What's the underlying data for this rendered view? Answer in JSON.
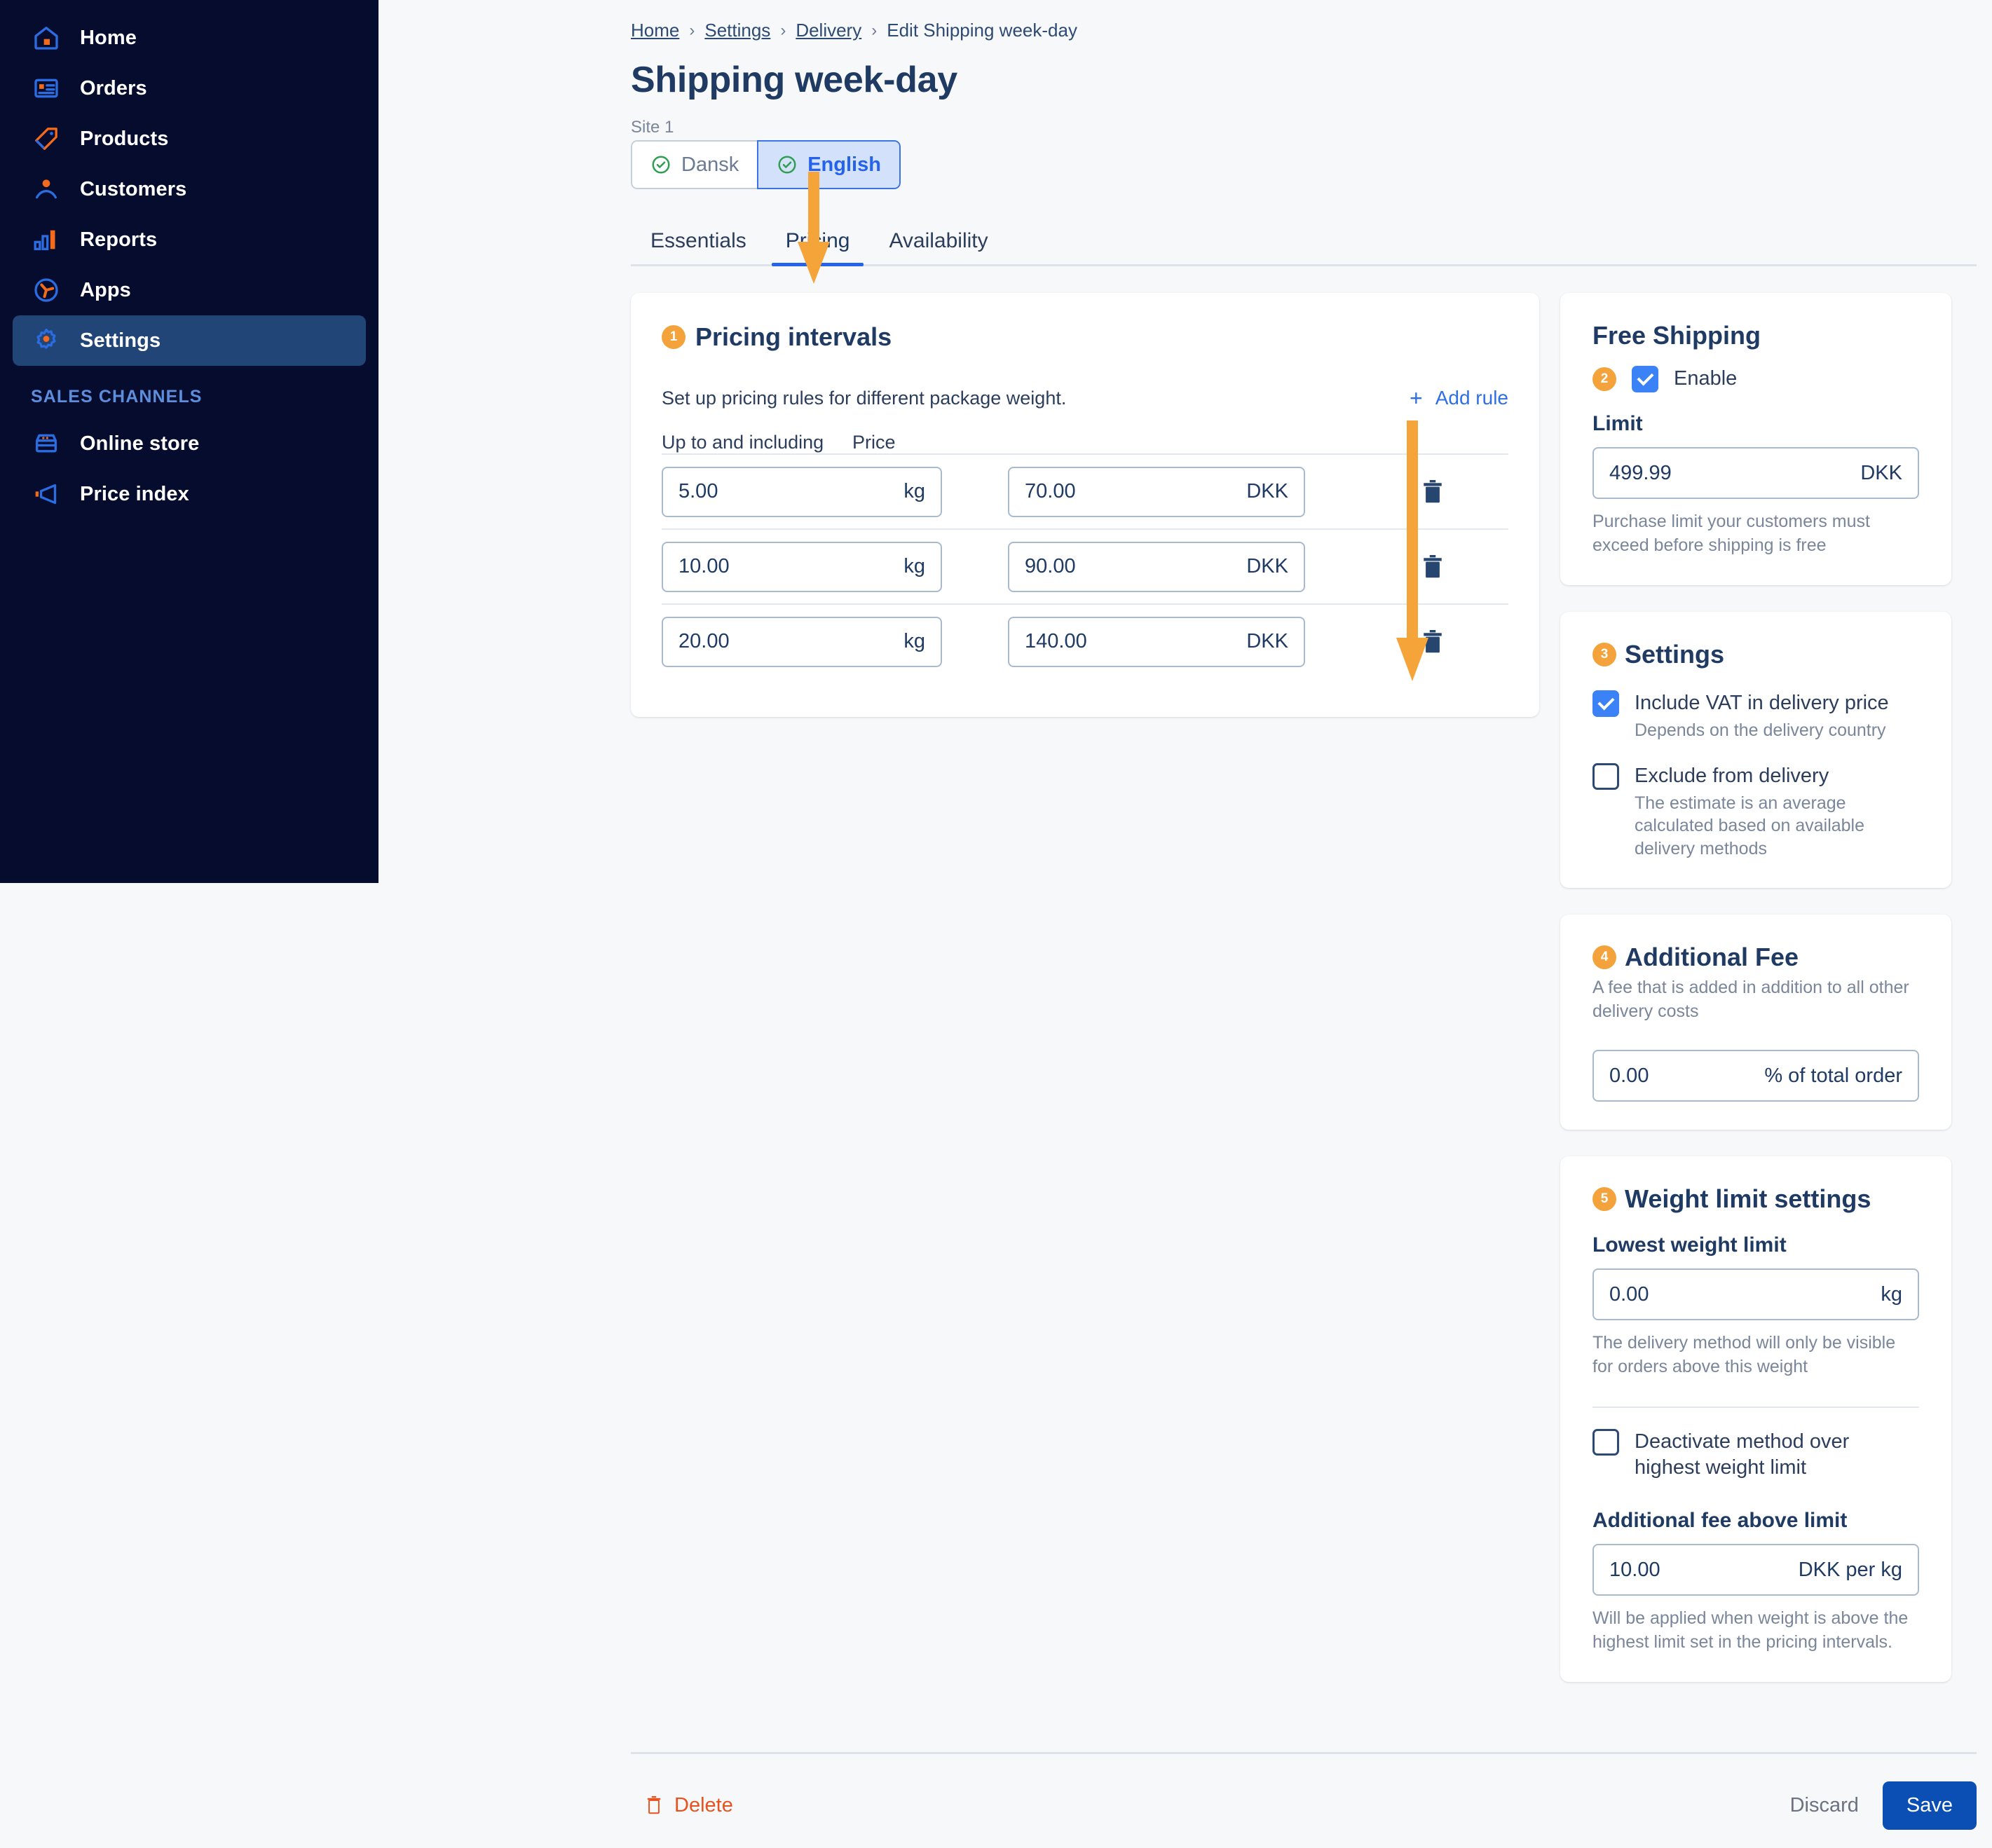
{
  "sidebar": {
    "items": [
      {
        "label": "Home",
        "icon": "home-icon"
      },
      {
        "label": "Orders",
        "icon": "orders-icon"
      },
      {
        "label": "Products",
        "icon": "products-tag-icon"
      },
      {
        "label": "Customers",
        "icon": "customers-icon"
      },
      {
        "label": "Reports",
        "icon": "reports-bar-chart-icon"
      },
      {
        "label": "Apps",
        "icon": "apps-icon"
      },
      {
        "label": "Settings",
        "icon": "gear-icon",
        "active": true
      }
    ],
    "section_label": "SALES CHANNELS",
    "channels": [
      {
        "label": "Online store",
        "icon": "store-icon"
      },
      {
        "label": "Price index",
        "icon": "megaphone-icon"
      }
    ]
  },
  "breadcrumb": {
    "items": [
      "Home",
      "Settings",
      "Delivery"
    ],
    "current": "Edit Shipping week-day",
    "separator": "›"
  },
  "header": {
    "title": "Shipping week-day",
    "site_label": "Site 1",
    "languages": [
      {
        "label": "Dansk",
        "selected": false
      },
      {
        "label": "English",
        "selected": true
      }
    ]
  },
  "tabs": [
    {
      "label": "Essentials",
      "active": false
    },
    {
      "label": "Pricing",
      "active": true
    },
    {
      "label": "Availability",
      "active": false
    }
  ],
  "pricing": {
    "badge": "1",
    "title": "Pricing intervals",
    "description": "Set up pricing rules for different package weight.",
    "add_rule_label": "Add rule",
    "add_rule_plus": "+",
    "columns": [
      "Up to and including",
      "Price"
    ],
    "weight_unit": "kg",
    "price_unit": "DKK",
    "rows": [
      {
        "weight": "5.00",
        "price": "70.00"
      },
      {
        "weight": "10.00",
        "price": "90.00"
      },
      {
        "weight": "20.00",
        "price": "140.00"
      }
    ]
  },
  "free_shipping": {
    "title": "Free Shipping",
    "badge": "2",
    "enable_label": "Enable",
    "enable_checked": true,
    "limit_label": "Limit",
    "limit_value": "499.99",
    "limit_unit": "DKK",
    "limit_help": "Purchase limit your customers must exceed before shipping is free"
  },
  "settings_card": {
    "badge": "3",
    "title": "Settings",
    "options": [
      {
        "label": "Include VAT in delivery price",
        "sub": "Depends on the delivery country",
        "checked": true
      },
      {
        "label": "Exclude from delivery",
        "sub": "The estimate is an average calculated based on available delivery methods",
        "checked": false
      }
    ]
  },
  "additional_fee": {
    "badge": "4",
    "title": "Additional Fee",
    "sub": "A fee that is added in addition to all other delivery costs",
    "value": "0.00",
    "unit": "% of total order"
  },
  "weight_limit": {
    "badge": "5",
    "title": "Weight limit settings",
    "lowest_label": "Lowest weight limit",
    "lowest_value": "0.00",
    "lowest_unit": "kg",
    "lowest_help": "The delivery method will only be visible for orders above this weight",
    "deactivate_label": "Deactivate method over highest weight limit",
    "deactivate_checked": false,
    "fee_label": "Additional fee above limit",
    "fee_value": "10.00",
    "fee_unit": "DKK per kg",
    "fee_help": "Will be applied when weight is above the highest limit set in the pricing intervals."
  },
  "footer": {
    "delete_label": "Delete",
    "discard_label": "Discard",
    "save_label": "Save"
  },
  "colors": {
    "sidebar_bg": "#060c2e",
    "sidebar_active": "#204576",
    "accent_blue": "#2563eb",
    "icon_orange": "#f26a1b",
    "badge_orange": "#f3a23c",
    "annotation_orange": "#f5a43a",
    "navy_text": "#1f3a63",
    "danger": "#e8521f",
    "save_blue": "#0b4fb4"
  }
}
